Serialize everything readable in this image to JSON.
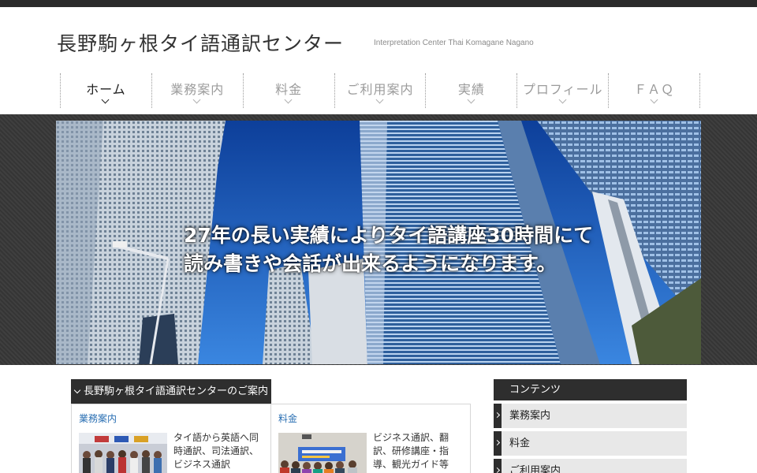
{
  "header": {
    "title": "長野駒ヶ根タイ語通訳センター",
    "subtitle": "Interpretation Center Thai Komagane Nagano"
  },
  "nav": {
    "items": [
      {
        "label": "ホーム",
        "active": true
      },
      {
        "label": "業務案内"
      },
      {
        "label": "料金"
      },
      {
        "label": "ご利用案内"
      },
      {
        "label": "実績"
      },
      {
        "label": "プロフィール"
      },
      {
        "label": "ＦＡＱ"
      }
    ]
  },
  "hero": {
    "line1": "27年の長い実績によりタイ語講座30時間にて",
    "line2": "読み書きや会話が出来るようになります。"
  },
  "intro": {
    "heading": "長野駒ヶ根タイ語通訳センターのご案内",
    "panels": [
      {
        "title": "業務案内",
        "text": "タイ語から英語へ同時通訳、司法通訳、ビジネス通訳"
      },
      {
        "title": "料金",
        "text": "ビジネス通訳、翻訳、研修講座・指導、観光ガイド等"
      }
    ]
  },
  "sidebar": {
    "heading": "コンテンツ",
    "items": [
      {
        "label": "業務案内"
      },
      {
        "label": "料金"
      },
      {
        "label": "ご利用案内"
      }
    ]
  },
  "colors": {
    "accent_link": "#2a6fb3",
    "dark_bar": "#2e2e2e",
    "sky": "#1f63c4"
  }
}
